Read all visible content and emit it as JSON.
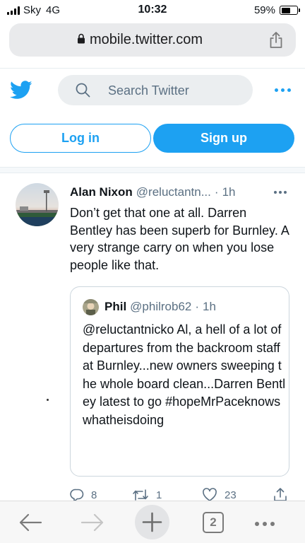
{
  "status_bar": {
    "carrier": "Sky",
    "network": "4G",
    "time": "10:32",
    "battery": "59%",
    "battery_level": 0.59
  },
  "browser": {
    "url": "mobile.twitter.com",
    "open_tabs": "2"
  },
  "header": {
    "search_placeholder": "Search Twitter",
    "login_label": "Log in",
    "signup_label": "Sign up"
  },
  "tweet": {
    "author_name": "Alan Nixon",
    "author_handle": "@reluctantn...",
    "separator": "·",
    "time": "1h",
    "text": "Don’t get that one at all. Darren Bentley has been superb for Burnley. A very strange carry on when you lose people like that.",
    "quoted": {
      "author_name": "Phil",
      "author_handle": "@philrob62",
      "separator": "·",
      "time": "1h",
      "text": "@reluctantnicko Al, a hell of a lot of departures from the backroom staff at Burnley...new owners sweeping the whole board clean...Darren Bentley latest to go #hopeMrPaceknowswhatheisdoing"
    },
    "stats": {
      "replies": "8",
      "retweets": "1",
      "likes": "23"
    }
  },
  "colors": {
    "brand": "#1da1f2",
    "secondary_text": "#5b7083"
  }
}
